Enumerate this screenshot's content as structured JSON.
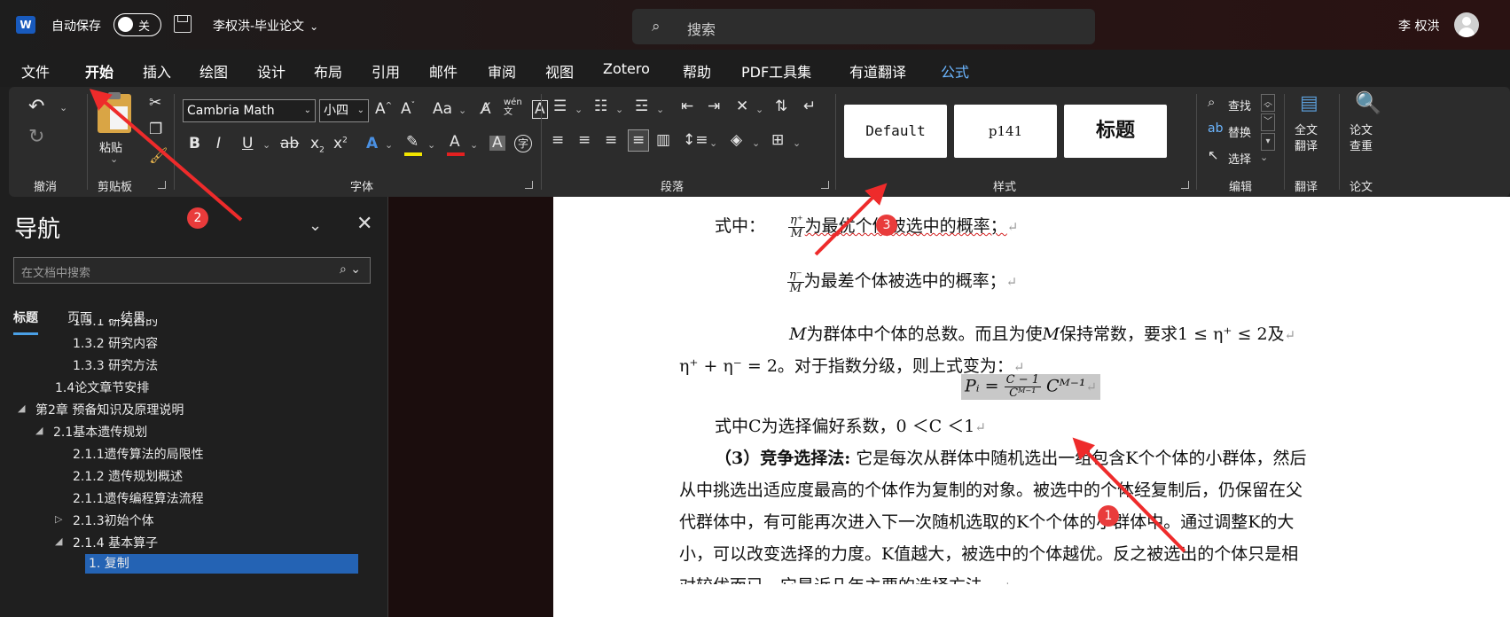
{
  "titlebar": {
    "app_logo": "W",
    "autosave_label": "自动保存",
    "autosave_state": "关",
    "doc_title": "李权洪-毕业论文",
    "search_placeholder": "搜索",
    "user_name": "李 权洪"
  },
  "menu": {
    "tabs": [
      "文件",
      "开始",
      "插入",
      "绘图",
      "设计",
      "布局",
      "引用",
      "邮件",
      "审阅",
      "视图",
      "Zotero",
      "帮助",
      "PDF工具集",
      "有道翻译",
      "公式"
    ],
    "active": "开始"
  },
  "ribbon": {
    "undo_group": "撤消",
    "clipboard_group": "剪贴板",
    "paste_label": "粘贴",
    "font_group": "字体",
    "font_name": "Cambria Math",
    "font_size": "小四",
    "paragraph_group": "段落",
    "styles_group": "样式",
    "styles": [
      "Default",
      "p141",
      "标题"
    ],
    "edit_group": "编辑",
    "find_label": "查找",
    "replace_label": "替换",
    "select_label": "选择",
    "translate_group": "翻译",
    "translate_label_1": "全文",
    "translate_label_2": "翻译",
    "paper_group": "论文",
    "paper_label_1": "论文",
    "paper_label_2": "查重",
    "icons": {
      "undo": "undo-icon",
      "redo": "redo-icon",
      "cut": "scissors-icon",
      "copy": "copy-icon",
      "format_painter": "brush-icon",
      "grow_font": "A^",
      "shrink_font": "A˅",
      "change_case": "Aa"
    },
    "highlight_color": "#f2e500",
    "font_color": "#e32020"
  },
  "nav": {
    "title": "导航",
    "search_placeholder": "在文档中搜索",
    "tabs": [
      "标题",
      "页面",
      "结果"
    ],
    "headings": [
      "1.3.1 研究目的",
      "1.3.2 研究内容",
      "1.3.3 研究方法",
      "1.4论文章节安排",
      "第2章 预备知识及原理说明",
      "2.1基本遗传规划",
      "2.1.1遗传算法的局限性",
      "2.1.2 遗传规划概述",
      "2.1.1遗传编程算法流程",
      "2.1.3初始个体",
      "2.1.4 基本算子",
      "1. 复制"
    ]
  },
  "document": {
    "l1_prefix": "式中：",
    "l1_frac_num": "η⁺",
    "l1_frac_den": "M",
    "l1_text": "为最优个体被选中的概率；",
    "l2_frac_num": "η⁻",
    "l2_frac_den": "M",
    "l2_text": "为最差个体被选中的概率；",
    "l3_text_a": "M",
    "l3_text_b": "为群体中个体的总数。而且为使",
    "l3_text_c": "M",
    "l3_text_d": "保持常数，要求1 ≤ η⁺ ≤ 2及",
    "l4_text": "η⁺ + η⁻ = 2。对于指数分级，则上式变为：",
    "formula": "Pᵢ = ",
    "formula_num": "C − 1",
    "formula_den": "Cᴹ⁻¹",
    "formula_tail": " Cᴹ⁻¹",
    "l5_text": "式中C为选择偏好系数，0 ＜C ＜1",
    "l6_bold": "（3）竞争选择法:",
    "l6_text": "   它是每次从群体中随机选出一组包含K个个体的小群体，然后",
    "l7_text": "从中挑选出适应度最高的个体作为复制的对象。被选中的个体经复制后，仍保留在父",
    "l8_text": "代群体中，有可能再次进入下一次随机选取的K个个体的小群体中。通过调整K的大",
    "l9_text": "小，可以改变选择的力度。K值越大，被选中的个体越优。反之被选出的个体只是相",
    "l10_text": "对较优而已。它是近几年主要的选择方法。",
    "para_mark": "↵"
  },
  "annotations": [
    "1",
    "2",
    "3"
  ]
}
